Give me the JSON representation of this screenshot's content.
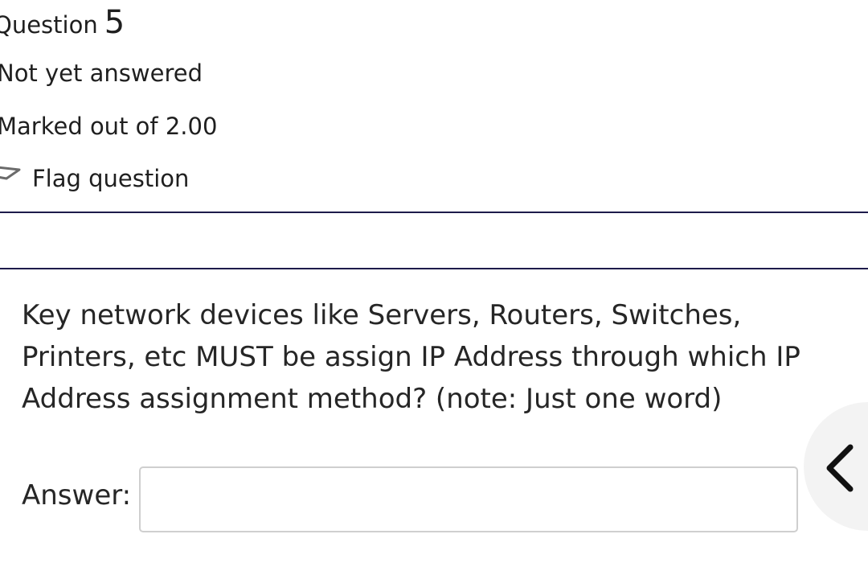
{
  "question": {
    "title_word": "Question",
    "number": "5",
    "state": "Not yet answered",
    "grade": "Marked out of 2.00",
    "flag_label": "Flag question",
    "text": "Key network devices like Servers, Routers, Switches, Printers, etc MUST be assign IP Address through which IP Address assignment method? (note: Just one word)",
    "answer_label": "Answer:",
    "answer_value": ""
  },
  "icons": {
    "flag": "flag-icon",
    "drawer_toggle": "chevron-left-icon"
  },
  "colors": {
    "divider": "#1e1b4b",
    "text": "#262626",
    "input_border": "#cfcfcf",
    "side_tab_bg": "#f3f3f3"
  }
}
